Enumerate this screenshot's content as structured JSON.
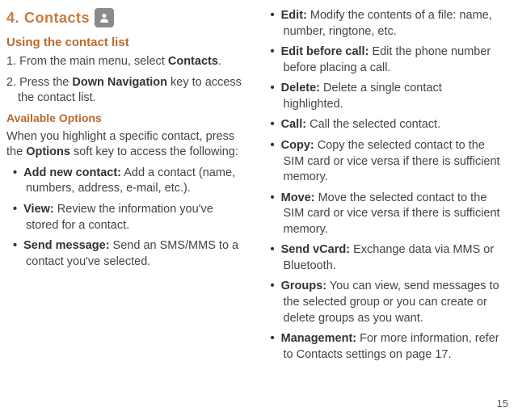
{
  "section": {
    "number": "4.",
    "title": "Contacts"
  },
  "sub1": "Using the contact list",
  "steps": [
    {
      "num": "1.",
      "pre": "From the main menu, select ",
      "bold": "Contacts",
      "post": "."
    },
    {
      "num": "2.",
      "pre": "Press the ",
      "bold": "Down Navigation",
      "post": " key to access the contact list."
    }
  ],
  "avail": "Available Options",
  "intro": {
    "pre": "When you highlight a specific contact, press the ",
    "bold": "Options",
    "post": " soft key to access the following:"
  },
  "leftBullets": [
    {
      "label": "Add new contact:",
      "text": " Add a contact (name, numbers, address, e-mail, etc.)."
    },
    {
      "label": "View:",
      "text": " Review the information you've stored for a contact."
    },
    {
      "label": "Send message:",
      "text": " Send an SMS/MMS to a contact you've selected."
    }
  ],
  "rightBullets": [
    {
      "label": "Edit:",
      "text": " Modify the contents of a file: name, number, ringtone, etc."
    },
    {
      "label": "Edit before call:",
      "text": " Edit the phone number before placing a call."
    },
    {
      "label": "Delete:",
      "text": " Delete a single contact highlighted."
    },
    {
      "label": "Call:",
      "text": " Call the selected contact."
    },
    {
      "label": "Copy:",
      "text": " Copy the selected contact to the SIM card or vice versa if there is sufficient memory."
    },
    {
      "label": "Move:",
      "text": " Move the selected contact to the SIM card or vice versa if there is sufficient memory."
    },
    {
      "label": "Send vCard:",
      "text": " Exchange data via MMS or Bluetooth."
    },
    {
      "label": "Groups:",
      "text": " You can view, send messages to the selected group or you can create or delete groups as you want."
    },
    {
      "label": "Management:",
      "text": " For more information, refer to Contacts settings on page 17."
    }
  ],
  "pageNum": "15"
}
